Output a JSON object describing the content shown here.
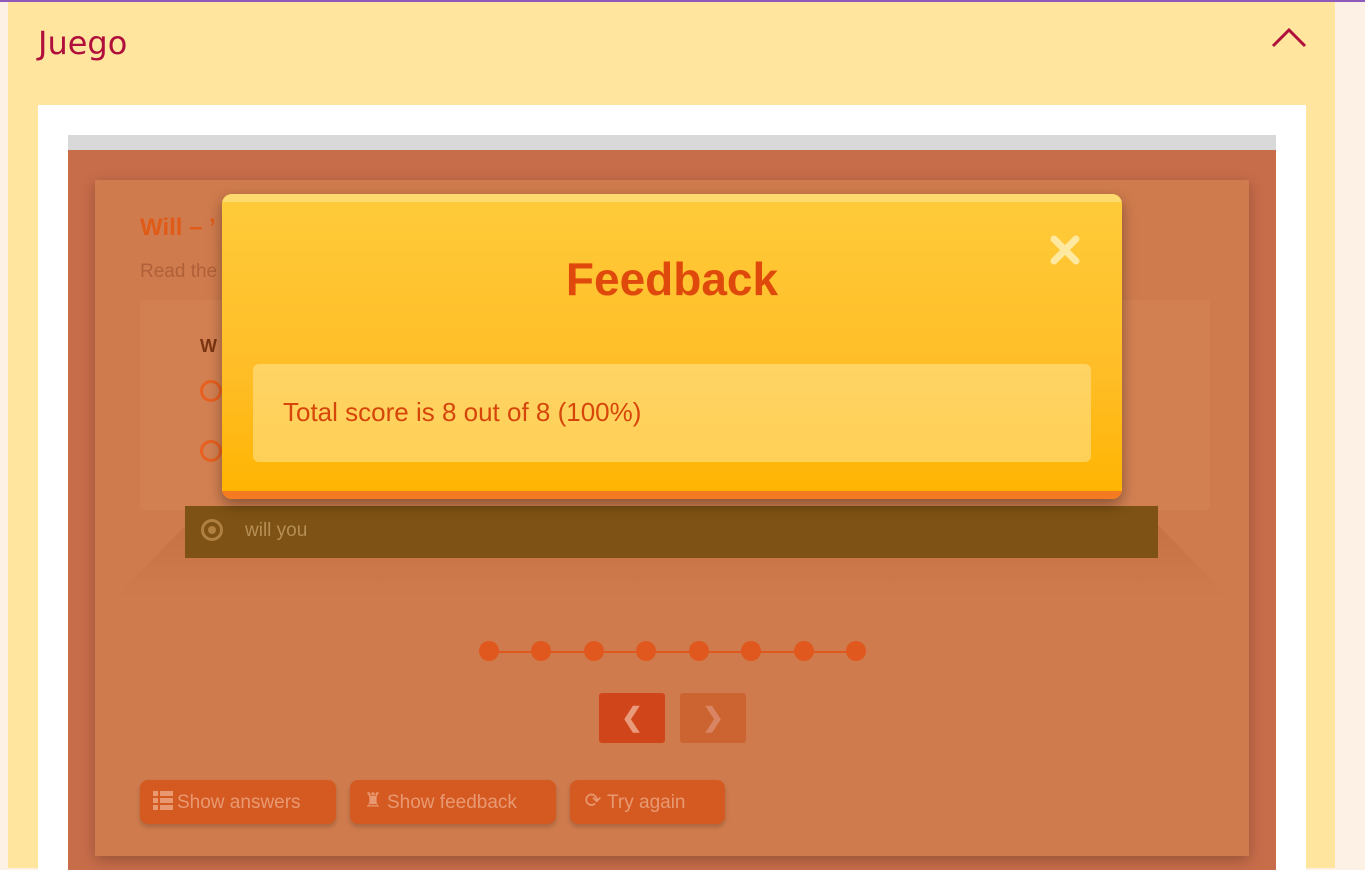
{
  "panel": {
    "title": "Juego",
    "collapse_icon": "chevron-up-icon"
  },
  "question": {
    "title": "Will – ’",
    "intro": "Read the",
    "text": "W",
    "selected_answer": "will you"
  },
  "pagination": {
    "total_steps": 8,
    "current_step": 8
  },
  "navigation": {
    "prev_icon": "chevron-left-icon",
    "next_icon": "chevron-right-icon"
  },
  "actions": {
    "show_answers": "Show answers",
    "show_feedback": "Show feedback",
    "try_again": "Try again"
  },
  "modal": {
    "title": "Feedback",
    "message": "Total score is 8 out of 8 (100%)",
    "close_icon": "close-icon"
  },
  "colors": {
    "panel_bg": "#ffe59e",
    "title_color": "#b00f3c",
    "modal_title": "#e0490c",
    "accent": "#e0581e"
  }
}
